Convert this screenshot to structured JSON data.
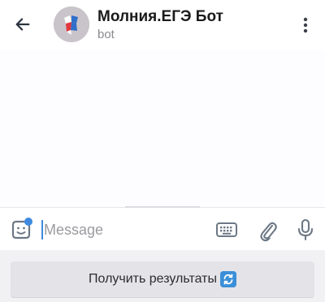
{
  "header": {
    "title": "Молния.ЕГЭ Бот",
    "subtitle": "bot"
  },
  "composer": {
    "placeholder": "Message"
  },
  "bot_keyboard": {
    "button_label": "Получить результаты"
  },
  "icons": {
    "back": "arrow-left-icon",
    "menu": "more-vertical-icon",
    "sticker": "sticker-icon",
    "keyboard": "keyboard-icon",
    "attach": "paperclip-icon",
    "mic": "microphone-icon",
    "refresh": "refresh-emoji-icon"
  },
  "colors": {
    "accent": "#3f8ae0",
    "icon": "#6d7885",
    "title": "#1a1a1a",
    "subtitle": "#8a8a8f"
  }
}
